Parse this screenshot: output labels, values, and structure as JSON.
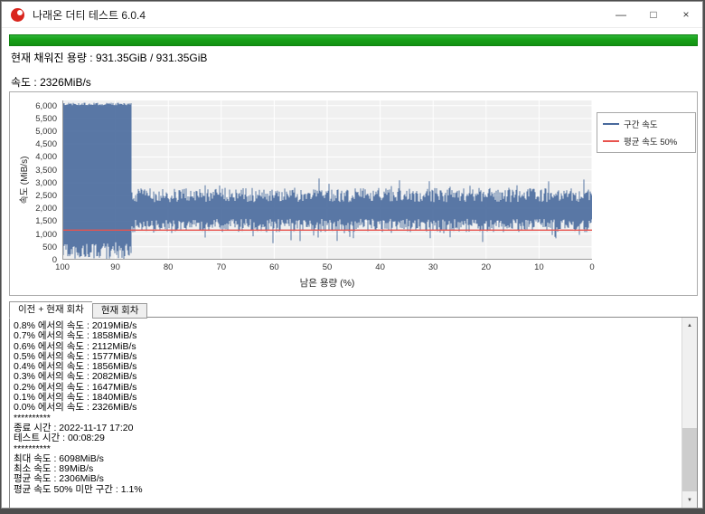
{
  "window": {
    "title": "나래온 더티 테스트 6.0.4",
    "controls": {
      "minimize": "—",
      "maximize": "□",
      "close": "×"
    }
  },
  "progress": {
    "value_percent": 100,
    "color": "#17a017"
  },
  "status": {
    "capacity_label": "현재 채워진 용량 : 931.35GiB / 931.35GiB",
    "speed_label": "속도 : 2326MiB/s"
  },
  "chart_data": {
    "type": "line",
    "xlabel": "남은 용량 (%)",
    "ylabel": "속도 (MiB/s)",
    "x_reversed": true,
    "x_ticks": [
      "100",
      "90",
      "80",
      "70",
      "60",
      "50",
      "40",
      "30",
      "20",
      "10",
      "0"
    ],
    "y_ticks": [
      "0",
      "500",
      "1,000",
      "1,500",
      "2,000",
      "2,500",
      "3,000",
      "3,500",
      "4,000",
      "4,500",
      "5,000",
      "5,500",
      "6,000"
    ],
    "y_tick_values": [
      0,
      500,
      1000,
      1500,
      2000,
      2500,
      3000,
      3500,
      4000,
      4500,
      5000,
      5500,
      6000
    ],
    "ylim": [
      0,
      6200
    ],
    "plot_bg": "#f0f0f0",
    "grid_color": "#ffffff",
    "axis_color": "#9a9a9a",
    "legend": [
      {
        "label": "구간 속도",
        "color": "#48699c"
      },
      {
        "label": "평균 속도 50%",
        "color": "#e8534e"
      }
    ],
    "series": [
      {
        "name": "구간 속도",
        "color": "#48699c",
        "seed": 20221117,
        "profile": {
          "cache_phase": {
            "x_from": 100,
            "x_to": 87,
            "top_mean": 6060,
            "top_jitter": 50,
            "bottom_mean": 350,
            "bottom_jitter": 330
          },
          "steady_phase": {
            "x_from": 87,
            "x_to": 0,
            "top_mean": 2520,
            "top_jitter": 280,
            "bottom_mean": 1330,
            "bottom_jitter": 260,
            "spike_top_chance": 0.05,
            "spike_top_extra": 450,
            "spike_bottom_chance": 0.06,
            "spike_bottom_extra": 420
          }
        }
      },
      {
        "name": "평균 속도 50%",
        "color": "#e8534e",
        "value": 1153
      }
    ],
    "events": [
      {
        "x_pct": 60.3,
        "bottom": 640
      },
      {
        "x_pct": 51.5,
        "top": 3160
      },
      {
        "x_pct": 30.5,
        "bottom": 840
      },
      {
        "x_pct": 8.2,
        "top": 3050
      }
    ],
    "stats": {
      "max_speed": 6098,
      "min_speed": 89,
      "avg_speed": 2306,
      "below_50_section": "1.1%"
    }
  },
  "tabs": [
    {
      "label": "이전 + 현재 회차",
      "selected": true
    },
    {
      "label": "현재 회차",
      "selected": false
    }
  ],
  "log": {
    "lines": [
      "0.8% 에서의 속도 : 2019MiB/s",
      "0.7% 에서의 속도 : 1858MiB/s",
      "0.6% 에서의 속도 : 2112MiB/s",
      "0.5% 에서의 속도 : 1577MiB/s",
      "0.4% 에서의 속도 : 1856MiB/s",
      "0.3% 에서의 속도 : 2082MiB/s",
      "0.2% 에서의 속도 : 1647MiB/s",
      "0.1% 에서의 속도 : 1840MiB/s",
      "0.0% 에서의 속도 : 2326MiB/s",
      "**********",
      "종료 시간 : 2022-11-17 17:20",
      "테스트 시간 : 00:08:29",
      "**********",
      "최대 속도 : 6098MiB/s",
      "최소 속도 : 89MiB/s",
      "평균 속도 : 2306MiB/s",
      "평균 속도 50% 미만 구간 : 1.1%"
    ]
  },
  "scrollbar": {
    "up_glyph": "▲",
    "down_glyph": "▼"
  }
}
